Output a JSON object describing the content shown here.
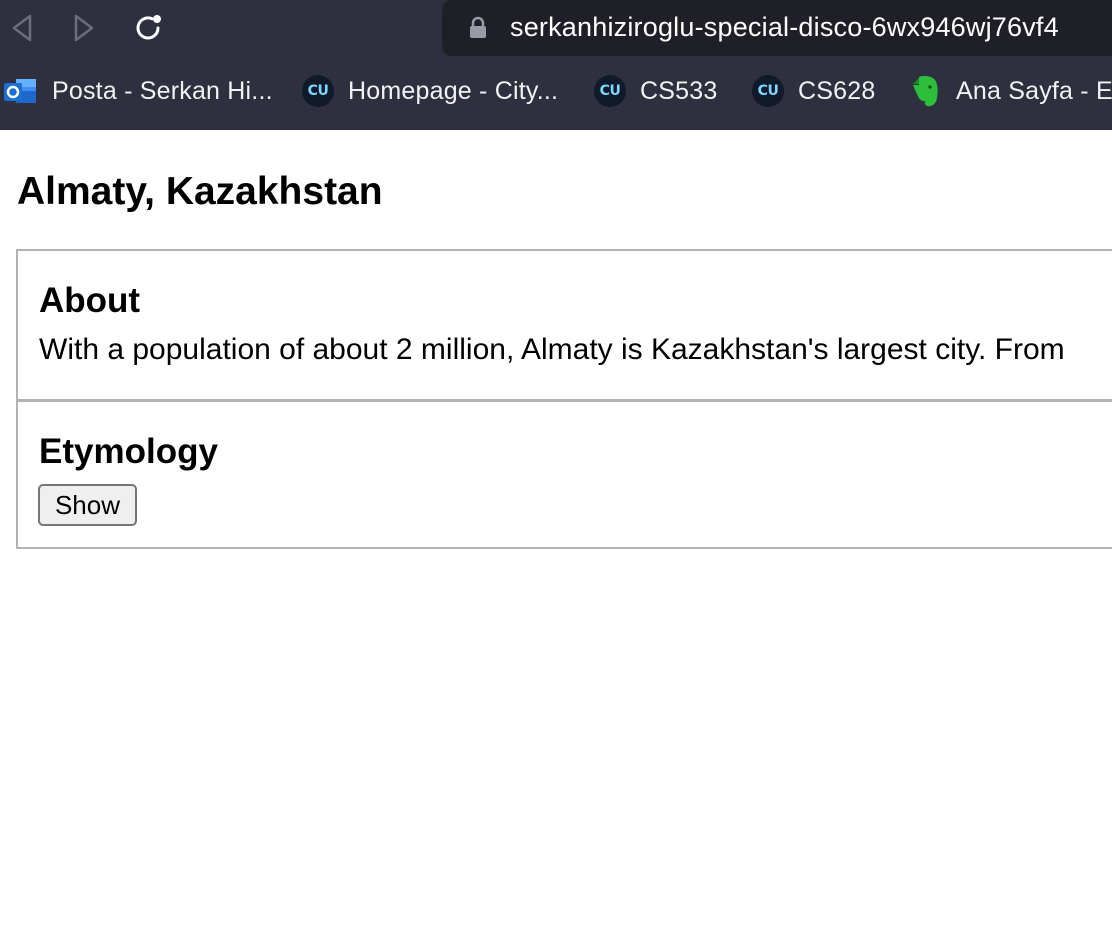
{
  "browser": {
    "url": "serkanhiziroglu-special-disco-6wx946wj76vf4",
    "bookmarks": [
      {
        "label": "Posta - Serkan Hi...",
        "icon": "outlook-icon"
      },
      {
        "label": "Homepage - City...",
        "icon": "cu-icon",
        "icon_text": "CU"
      },
      {
        "label": "CS533",
        "icon": "cu-icon",
        "icon_text": "CU"
      },
      {
        "label": "CS628",
        "icon": "cu-icon",
        "icon_text": "CU"
      },
      {
        "label": "Ana Sayfa - Ev",
        "icon": "evernote-icon"
      }
    ]
  },
  "page": {
    "title": "Almaty, Kazakhstan",
    "sections": [
      {
        "heading": "About",
        "text": "With a population of about 2 million, Almaty is Kazakhstan's largest city. From"
      },
      {
        "heading": "Etymology",
        "button_label": "Show"
      }
    ]
  },
  "colors": {
    "chrome_bg": "#2e2f3f",
    "urlbar_bg": "#1f1f27",
    "section_border": "#b3b3b3",
    "cu_icon_bg": "#101a2a",
    "cu_icon_fg": "#7fd6ff",
    "evernote_green": "#2dbe3c",
    "outlook_blue": "#1a6fd1"
  }
}
